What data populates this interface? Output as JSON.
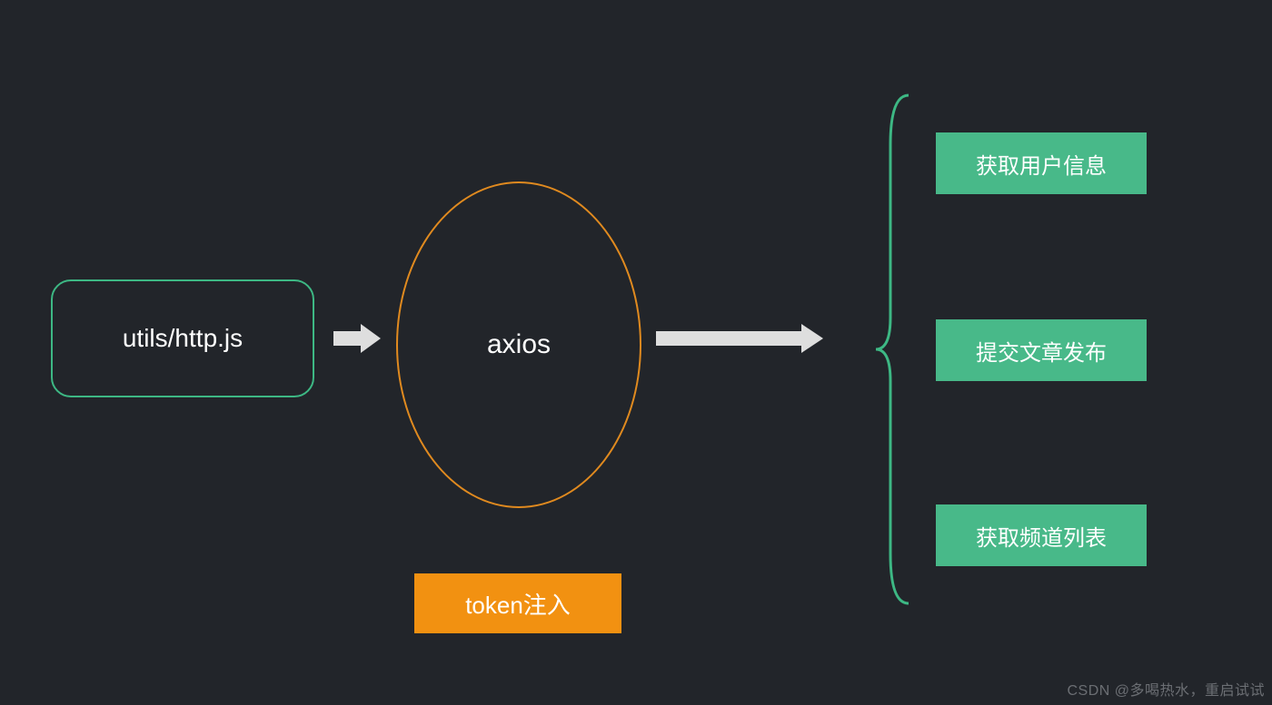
{
  "source": {
    "label": "utils/http.js"
  },
  "middle": {
    "label": "axios"
  },
  "token": {
    "label": "token注入"
  },
  "actions": {
    "a1": "获取用户信息",
    "a2": "提交文章发布",
    "a3": "获取频道列表"
  },
  "watermark": "CSDN @多喝热水，重启试试"
}
